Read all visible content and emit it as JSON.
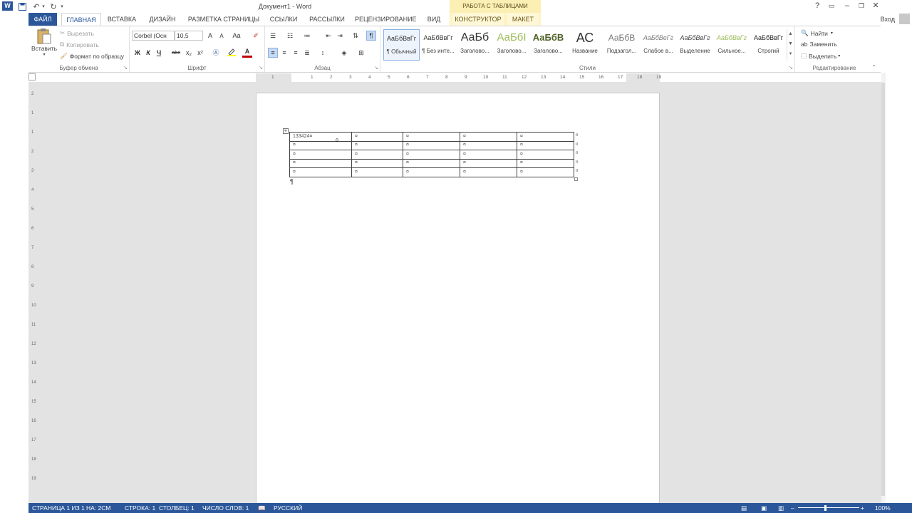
{
  "titlebar": {
    "doc_title": "Документ1 - Word",
    "context_header": "РАБОТА С ТАБЛИЦАМИ",
    "qat_icons": [
      "word-logo",
      "save-icon",
      "undo-icon",
      "redo-icon",
      "customize-qat-icon"
    ],
    "window_buttons": [
      "?",
      "▭",
      "–",
      "▢",
      "✕"
    ]
  },
  "tabs": {
    "file": "ФАЙЛ",
    "home": "ГЛАВНАЯ",
    "insert": "ВСТАВКА",
    "design": "ДИЗАЙН",
    "layout": "РАЗМЕТКА СТРАНИЦЫ",
    "references": "ССЫЛКИ",
    "mailings": "РАССЫЛКИ",
    "review": "РЕЦЕНЗИРОВАНИЕ",
    "view": "ВИД",
    "constructor": "КОНСТРУКТОР",
    "maket": "МАКЕТ",
    "signin": "Вход"
  },
  "clipboard": {
    "paste": "Вставить",
    "cut": "Вырезать",
    "copy": "Копировать",
    "format_painter": "Формат по образцу",
    "label": "Буфер обмена"
  },
  "font": {
    "font_name": "Corbel (Осн",
    "font_size": "10,5",
    "label": "Шрифт",
    "bold": "Ж",
    "italic": "К",
    "underline": "Ч",
    "strike": "abc",
    "subscript": "x₂",
    "superscript": "x²",
    "grow": "A",
    "shrink": "A",
    "case": "Aa",
    "color": "A"
  },
  "paragraph": {
    "label": "Абзац",
    "show_marks": "¶"
  },
  "styles": {
    "label": "Стили",
    "items": [
      {
        "sample": "АаБбВвГг",
        "name": "¶ Обычный",
        "color": "#333333"
      },
      {
        "sample": "АаБбВвГг",
        "name": "¶ Без инте...",
        "color": "#333333"
      },
      {
        "sample": "АаБб",
        "name": "Заголово...",
        "color": "#333333"
      },
      {
        "sample": "АаБбI",
        "name": "Заголово...",
        "color": "#9bbb59"
      },
      {
        "sample": "АаБбВ",
        "name": "Заголово...",
        "color": "#4f6228"
      },
      {
        "sample": "АС",
        "name": "Название",
        "color": "#333333"
      },
      {
        "sample": "АаБбВ",
        "name": "Подзагол...",
        "color": "#777777"
      },
      {
        "sample": "АаБбВеГг",
        "name": "Слабое в...",
        "color": "#777777"
      },
      {
        "sample": "АаБбВвГг",
        "name": "Выделение",
        "color": "#444444"
      },
      {
        "sample": "АаБбВвГг",
        "name": "Сильное...",
        "color": "#9bbb59"
      },
      {
        "sample": "АаБбВвГг",
        "name": "Строгий",
        "color": "#222222"
      }
    ]
  },
  "editing": {
    "label": "Редактирование",
    "find": "Найти",
    "replace": "Заменить",
    "select": "Выделить"
  },
  "ruler": {
    "h_ticks": [
      "1",
      "1",
      "2",
      "3",
      "4",
      "5",
      "6",
      "7",
      "8",
      "9",
      "10",
      "11",
      "12",
      "13",
      "14",
      "15",
      "16",
      "17",
      "18",
      "19"
    ],
    "v_ticks": [
      "2",
      "1",
      "1",
      "2",
      "3",
      "4",
      "5",
      "6",
      "7",
      "8",
      "9",
      "10",
      "11",
      "12",
      "13",
      "14",
      "15",
      "16",
      "17",
      "18",
      "19"
    ]
  },
  "document": {
    "table": [
      [
        "133424¤",
        "¤",
        "¤",
        "¤",
        "¤"
      ],
      [
        "¤",
        "¤",
        "¤",
        "¤",
        "¤"
      ],
      [
        "¤",
        "¤",
        "¤",
        "¤",
        "¤"
      ],
      [
        "¤",
        "¤",
        "¤",
        "¤",
        "¤"
      ],
      [
        "¤",
        "¤",
        "¤",
        "¤",
        "¤"
      ]
    ],
    "row_end_mark": "¤",
    "paragraph_mark": "¶"
  },
  "status": {
    "page": "СТРАНИЦА 1 ИЗ 1",
    "position": "НА: 2СМ",
    "line": "СТРОКА: 1",
    "column": "СТОЛБЕЦ: 1",
    "words": "ЧИСЛО СЛОВ: 1",
    "language": "РУССКИЙ",
    "zoom": "100%",
    "zoom_minus": "–",
    "zoom_plus": "+"
  },
  "colors": {
    "accent": "#2b579a",
    "context_tab": "#fcefb4"
  }
}
